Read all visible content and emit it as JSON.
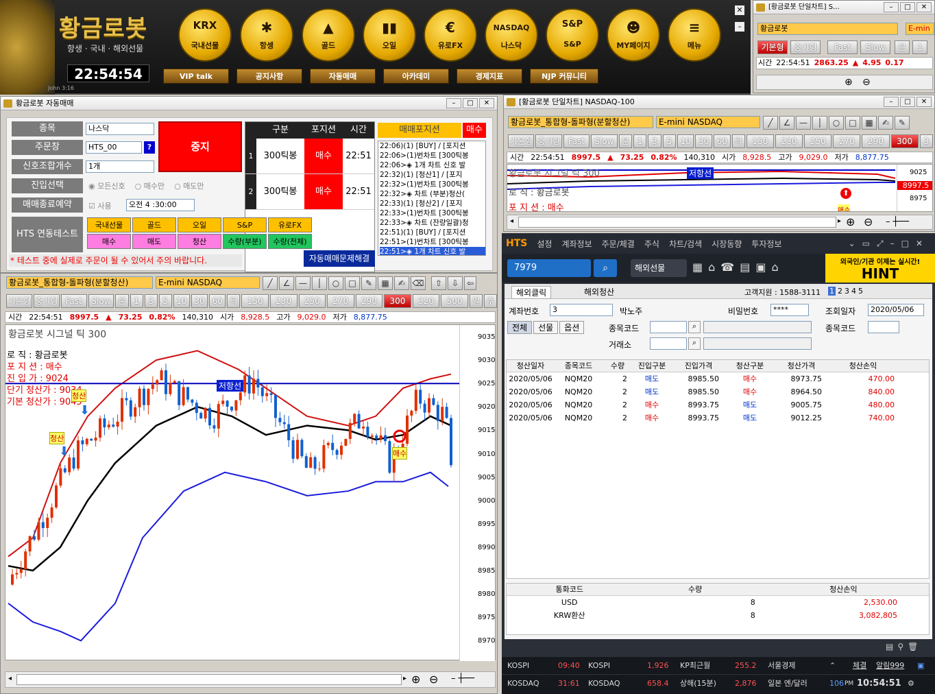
{
  "topbar": {
    "brand": "황금로봇",
    "subtitle": "항생 · 국내 · 해외선물",
    "clock": "22:54:54",
    "watermark": "John 3:16",
    "buttons": [
      {
        "icon": "KRX",
        "label": "국내선물"
      },
      {
        "icon": "✱",
        "label": "항셍"
      },
      {
        "icon": "▲",
        "label": "골드"
      },
      {
        "icon": "▮▮",
        "label": "오일"
      },
      {
        "icon": "€",
        "label": "유로FX"
      },
      {
        "icon": "NASDAQ",
        "label": "나스닥"
      },
      {
        "icon": "S&P",
        "label": "S&P"
      },
      {
        "icon": "☻",
        "label": "MY페이지"
      },
      {
        "icon": "≡",
        "label": "메뉴"
      }
    ],
    "subbuttons": [
      "VIP talk",
      "공지사항",
      "자동매매",
      "아카데미",
      "경제지표",
      "NJP 커뮤니티"
    ]
  },
  "mini": {
    "title": "[황금로봇 단일차트] S...",
    "name": "황금로봇",
    "product": "E-min",
    "tabs": [
      "기본형",
      "중기형",
      "Fast",
      "Slow",
      "분",
      "1"
    ],
    "time_label": "시간",
    "time": "22:54:51",
    "price": "2863.25",
    "arrow": "▲",
    "chg": "4.95",
    "rate": "0.17"
  },
  "auto": {
    "title": "황금로봇 자동매매",
    "labels": [
      "종목",
      "주문창",
      "신호조합개수",
      "진입선택",
      "매매종료예약"
    ],
    "fields": {
      "item": "나스닥",
      "order": "HTS_00",
      "combo": "1개",
      "help": "?",
      "use": "사용",
      "time": "오전  4 :30:00"
    },
    "entry_opts": [
      "모든신호",
      "매수만",
      "매도만"
    ],
    "stop": "중지",
    "table_head": [
      "구분",
      "포지션",
      "시간"
    ],
    "rows": [
      {
        "n": "1",
        "g": "300틱봉",
        "p": "매수",
        "t": "22:51"
      },
      {
        "n": "2",
        "g": "300틱봉",
        "p": "매수",
        "t": "22:51"
      }
    ],
    "sig_title": "매매포지션",
    "sig_buy": "매수",
    "logs": [
      "22:06)(1) [BUY] / [포지션",
      "22:06>(1)번차트 [300틱봉",
      "22:06>◈ 1개 차트 신호 발",
      "22:32)(1) [청산1] / [포지",
      "22:32>(1)번차트 [300틱봉",
      "22:32>◈ 차트 (부분)청산(",
      "22:33)(1) [청산2] / [포지",
      "22:33>(1)번차트 [300틱봉",
      "22:33>◈ 차트 (잔량일괄)청",
      "22:51)(1) [BUY] / [포지션",
      "22:51>(1)번차트 [300틱봉",
      "22:51>◈ 1개 차트 신호 발"
    ],
    "hts_label": "HTS 연동테스트",
    "hts_row1": [
      "국내선물",
      "골드",
      "오일",
      "S&P",
      "유로FX"
    ],
    "hts_row2": [
      "매수",
      "매도",
      "청산",
      "수량(부분)",
      "수량(전체)"
    ],
    "warning": "* 테스트 중에 실제로 주문이 될 수 있어서 주의 바랍니다.",
    "fix": "자동매매문제해결"
  },
  "chart": {
    "combo": "황금로봇_통합형-돌파형(분할청산)",
    "product": "E-mini NASDAQ",
    "tabs": [
      "기본형",
      "중기형",
      "Fast",
      "Slow",
      "분",
      "1",
      "3",
      "5",
      "10",
      "30",
      "60",
      "틱",
      "150",
      "230",
      "250",
      "270",
      "290",
      "300",
      "320",
      "500",
      "일",
      "주"
    ],
    "info": {
      "time_label": "시간",
      "time": "22:54:51",
      "price": "8997.5",
      "arrow": "▲",
      "chg": "73.25",
      "rate": "0.82%",
      "vol": "140,310",
      "open_l": "시가",
      "open": "8,928.5",
      "high_l": "고가",
      "high": "9,029.0",
      "low_l": "저가",
      "low": "8,877.75"
    },
    "title": "황금로봇 시그널 틱 300",
    "notes": [
      "로        직 : 황금로봇",
      "포  지  션 : 매수",
      "진  입  가 : 9024",
      "단기 청산가 : 9034",
      "기본 청산가 : 9045"
    ],
    "tags": [
      "저항선",
      "청산",
      "청산",
      "매수"
    ],
    "yticks": [
      "9035",
      "9030",
      "9025",
      "9020",
      "9015",
      "9010",
      "9005",
      "9000",
      "8995",
      "8990",
      "8985",
      "8980",
      "8975",
      "8970"
    ]
  },
  "chart2": {
    "title": "[황금로봇 단일차트] NASDAQ-100",
    "combo": "황금로봇_통합형-돌파형(분할청산)",
    "product": "E-mini NASDAQ",
    "tabs": [
      "기본형",
      "중기형",
      "Fast",
      "Slow",
      "분",
      "1",
      "3",
      "5",
      "10",
      "30",
      "60",
      "틱",
      "150",
      "230",
      "250",
      "270",
      "290",
      "300",
      "3"
    ],
    "info": {
      "time": "22:54:51",
      "price": "8997.5",
      "chg": "73.25",
      "rate": "0.82%",
      "vol": "140,310",
      "open": "8,928.5",
      "high": "9,029.0",
      "low": "8,877.75"
    },
    "title2": "황금로봇 시그널 틱 300",
    "note": "포  지  션 : 매수",
    "note2": "로 직 : 황금로봇",
    "tag": "저항선",
    "last": "8997.5",
    "y1": "9025",
    "y2": "8975",
    "sig": "매수"
  },
  "hts": {
    "logo": "HTS",
    "menu": [
      "설정",
      "계좌정보",
      "주문/체결",
      "주식",
      "차트/검색",
      "시장동향",
      "투자정보"
    ],
    "acct": "7979",
    "market": "해외선물",
    "hint_top": "외국인/기관 이제는 실시간!",
    "hint": "HINT",
    "tabs": [
      "해외클릭",
      "해외청산"
    ],
    "support": "고객지원 : 1588-3111",
    "pages": [
      "1",
      "2",
      "3",
      "4",
      "5"
    ],
    "labels": {
      "acct_no": "계좌번호",
      "pw": "비밀번호",
      "date": "조회일자",
      "item_code": "종목코드",
      "exchange": "거래소",
      "item_code2": "종목코드"
    },
    "acct_sub": "3",
    "name": "박노주",
    "pw": "****",
    "date_val": "2020/05/06",
    "filter": [
      "전체",
      "선물",
      "옵션"
    ],
    "head": [
      "청산일자",
      "종목코드",
      "수량",
      "진입구분",
      "진입가격",
      "청산구분",
      "청산가격",
      "청산손익"
    ],
    "rows": [
      [
        "2020/05/06",
        "NQM20",
        "2",
        "매도",
        "8985.50",
        "매수",
        "8973.75",
        "470.00"
      ],
      [
        "2020/05/06",
        "NQM20",
        "2",
        "매도",
        "8985.50",
        "매수",
        "8964.50",
        "840.00"
      ],
      [
        "2020/05/06",
        "NQM20",
        "2",
        "매수",
        "8993.75",
        "매도",
        "9005.75",
        "480.00"
      ],
      [
        "2020/05/06",
        "NQM20",
        "2",
        "매수",
        "8993.75",
        "매도",
        "9012.25",
        "740.00"
      ]
    ],
    "sum_head": [
      "통화코드",
      "수량",
      "청산손익"
    ],
    "sum": [
      [
        "USD",
        "8",
        "2,530.00"
      ],
      [
        "KRW환산",
        "8",
        "3,082,805"
      ]
    ],
    "ticker": [
      {
        "a": "KOSPI",
        "b": "09:40",
        "c": "KOSPI",
        "d": "1,926",
        "e": "KP최근월",
        "f": "255.2",
        "g": "서울경제"
      },
      {
        "a": "KOSDAQ",
        "b": "31:61",
        "c": "KOSDAQ",
        "d": "658.4",
        "e": "상해(15분)",
        "f": "2,876",
        "g": "일본 엔/달러"
      }
    ],
    "status": {
      "a": "체결",
      "b": "알림999",
      "pm": "PM",
      "clock": "10:54:51",
      "yen": "106"
    }
  }
}
